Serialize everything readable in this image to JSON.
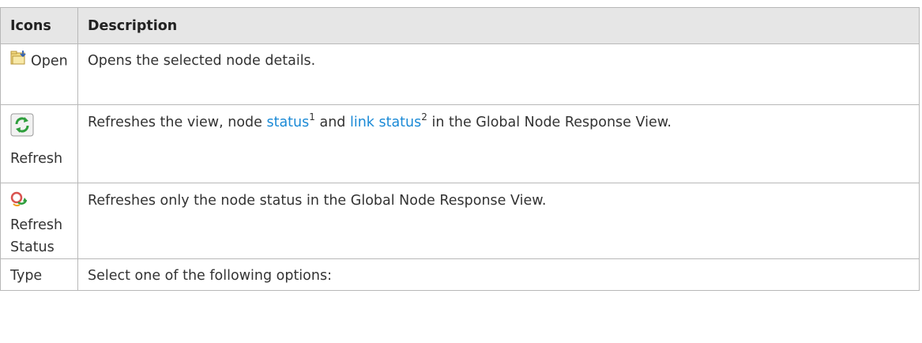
{
  "table": {
    "headers": {
      "icons": "Icons",
      "description": "Description"
    },
    "rows": [
      {
        "icon_name": "open-folder-icon",
        "label": "Open",
        "description": "Opens the selected node details."
      },
      {
        "icon_name": "refresh-icon",
        "label": "Refresh",
        "description_prefix": "Refreshes the view, node ",
        "link1_text": "status",
        "sup1": "1",
        "description_middle": " and ",
        "link2_text": "link status",
        "sup2": "2",
        "description_suffix": " in the Global Node Response View."
      },
      {
        "icon_name": "refresh-status-icon",
        "label_line1": "Refresh",
        "label_line2": "Status",
        "description": "Refreshes only the node status in the Global Node Response View."
      },
      {
        "label": "Type",
        "description": "Select one of the following options:"
      }
    ]
  },
  "colors": {
    "link": "#1b8ad6",
    "header_bg": "#e6e6e6",
    "border": "#b8b8b8"
  }
}
